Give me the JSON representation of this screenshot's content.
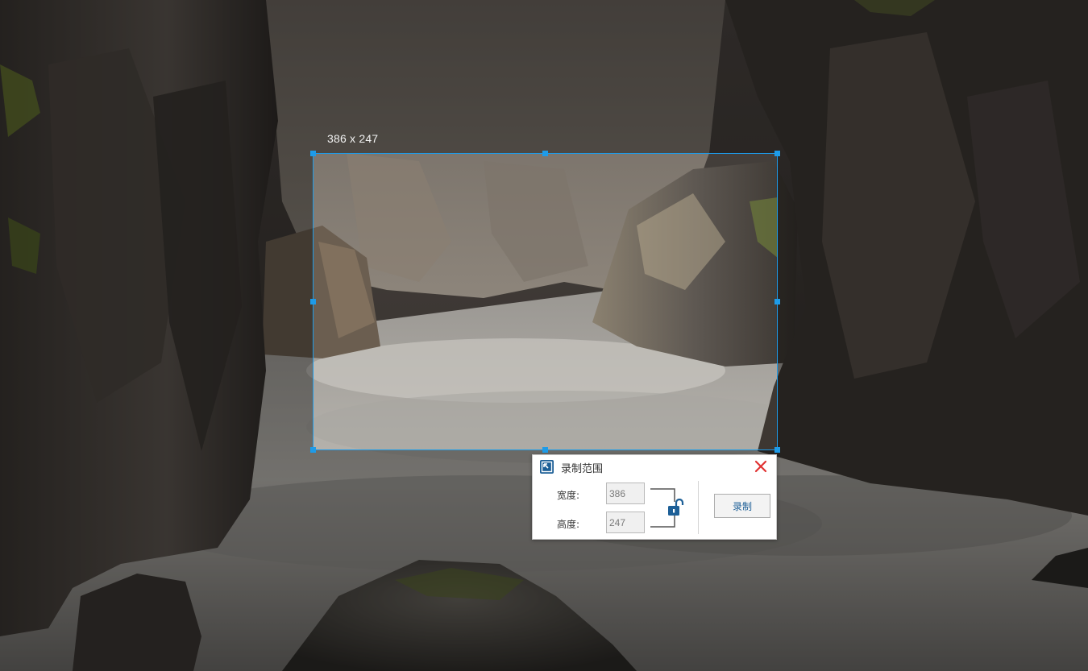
{
  "selection": {
    "size_label": "386 x 247"
  },
  "dialog": {
    "title": "录制范围",
    "width_label": "宽度:",
    "width_value": "386",
    "height_label": "高度:",
    "height_value": "247",
    "record_button": "录制"
  },
  "icons": {
    "app": "capture-region-icon",
    "close": "close-icon",
    "lock": "unlock-icon",
    "link": "aspect-link-bracket-icon"
  },
  "colors": {
    "selection_border": "#1e9be8",
    "close_red": "#e03131",
    "accent_blue": "#1d5f97"
  }
}
